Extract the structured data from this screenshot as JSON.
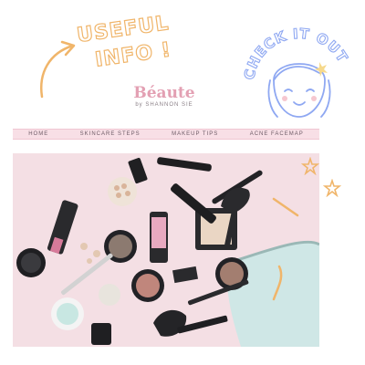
{
  "doodles": {
    "left_text_line1": "USEFUL",
    "left_text_line2": "INFO !",
    "right_text": "CHECK IT OUT"
  },
  "logo": {
    "name": "Béaute",
    "byline": "by SHANNON SIE"
  },
  "nav": {
    "items": [
      {
        "label": "HOME"
      },
      {
        "label": "SKINCARE STEPS"
      },
      {
        "label": "MAKEUP TIPS"
      },
      {
        "label": "ACNE FACEMAP"
      }
    ]
  },
  "colors": {
    "accent_pink": "#e3a0b3",
    "doodle_orange": "#f0b56a",
    "doodle_blue": "#8fa8f2",
    "nav_bg": "#f8dfe6",
    "hero_bg": "#f4dfe4"
  }
}
